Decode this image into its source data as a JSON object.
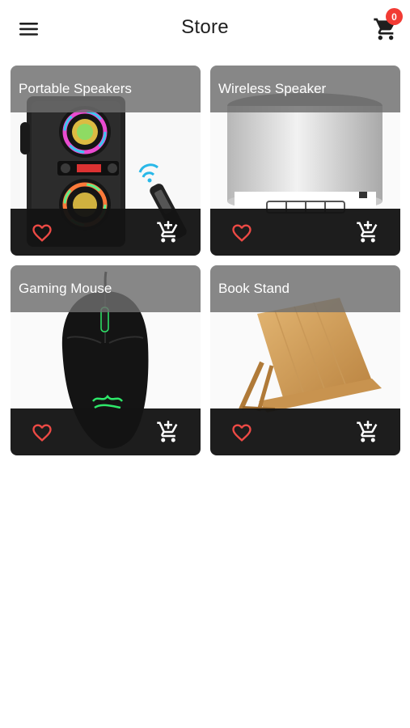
{
  "header": {
    "title": "Store",
    "cart_count": "0"
  },
  "products": [
    {
      "name": "Portable Speakers"
    },
    {
      "name": "Wireless Speaker"
    },
    {
      "name": "Gaming Mouse"
    },
    {
      "name": "Book Stand"
    }
  ],
  "icons": {
    "menu": "menu-icon",
    "cart": "cart-icon",
    "favorite": "heart-outline-icon",
    "add_to_cart": "add-to-cart-icon"
  },
  "colors": {
    "badge": "#f23b34",
    "heart": "#ee4a45",
    "action_bar": "#141414",
    "title_bar": "#6e6e6e"
  }
}
